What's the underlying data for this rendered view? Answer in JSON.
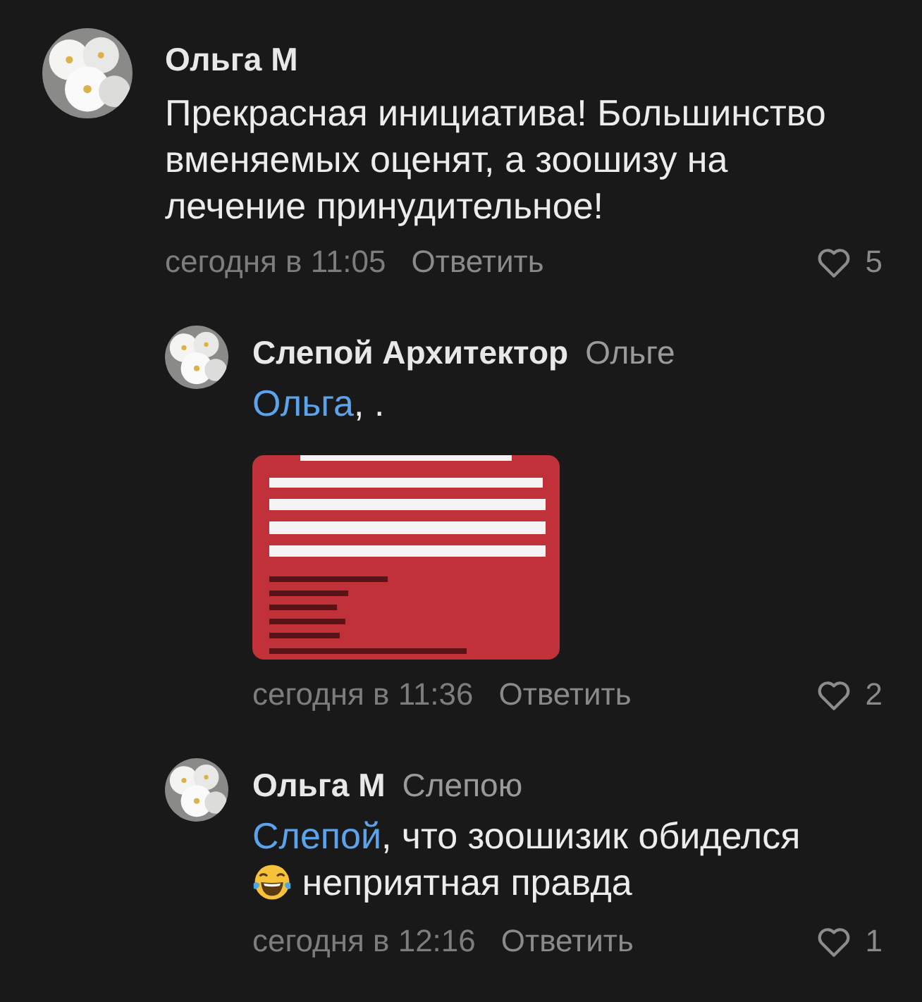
{
  "comments": [
    {
      "author": "Ольга М",
      "body": [
        {
          "kind": "text",
          "text": "Прекрасная инициатива! Большинство вменяемых оценят, а зоошизу на лечение принудительное!"
        }
      ],
      "time": "сегодня в 11:05",
      "reply_label": "Ответить",
      "likes": "5",
      "replies": [
        {
          "author": "Слепой Архитектор",
          "reply_to": "Ольге",
          "body": [
            {
              "kind": "mention",
              "text": "Ольга"
            },
            {
              "kind": "text",
              "text": ", ."
            }
          ],
          "time": "сегодня в 11:36",
          "reply_label": "Ответить",
          "likes": "2"
        },
        {
          "author": "Ольга М",
          "reply_to": "Слепою",
          "body": [
            {
              "kind": "mention",
              "text": "Слепой"
            },
            {
              "kind": "text",
              "text": ", что зоошизик обиделся "
            },
            {
              "kind": "emoji"
            },
            {
              "kind": "text",
              "text": " неприятная правда"
            }
          ],
          "time": "сегодня в 12:16",
          "reply_label": "Ответить",
          "likes": "1"
        }
      ]
    }
  ]
}
